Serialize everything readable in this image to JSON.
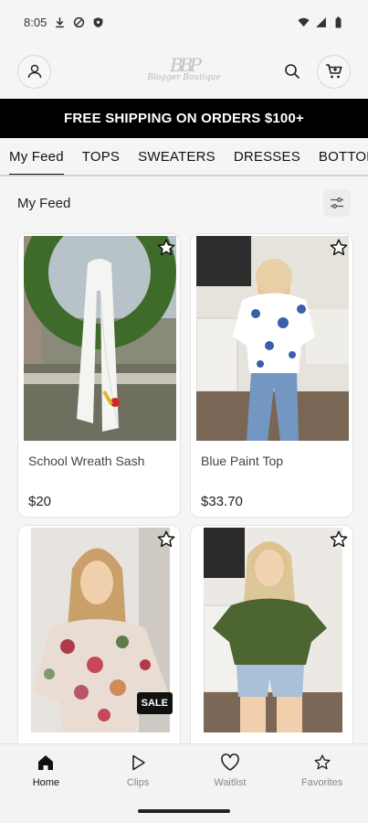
{
  "status_bar": {
    "time": "8:05",
    "icons": [
      "download-icon",
      "shield-icon",
      "shield-alt-icon",
      "wifi-icon",
      "signal-icon",
      "battery-icon"
    ]
  },
  "app_bar": {
    "logo_monogram": "BBP",
    "logo_text": "Blogger Boutique",
    "icons": [
      "profile-icon",
      "search-icon",
      "cart-icon"
    ]
  },
  "banner": {
    "text": "FREE SHIPPING ON ORDERS $100+"
  },
  "tabs": [
    {
      "label": "My Feed",
      "active": true
    },
    {
      "label": "TOPS"
    },
    {
      "label": "SWEATERS"
    },
    {
      "label": "DRESSES"
    },
    {
      "label": "BOTTOMS"
    }
  ],
  "feed": {
    "title": "My Feed",
    "products": [
      {
        "name": "School Wreath Sash",
        "price": "$20"
      },
      {
        "name": "Blue Paint Top",
        "price": "$33.70"
      },
      {
        "name": "",
        "price": "",
        "badge": "SALE"
      },
      {
        "name": "",
        "price": ""
      }
    ]
  },
  "bottom_nav": [
    {
      "label": "Home",
      "icon": "home-icon",
      "active": true
    },
    {
      "label": "Clips",
      "icon": "play-icon"
    },
    {
      "label": "Waitlist",
      "icon": "heart-icon"
    },
    {
      "label": "Favorites",
      "icon": "star-icon"
    }
  ],
  "colors": {
    "banner_bg": "#000000",
    "accent": "#111111",
    "background": "#f5f5f5"
  }
}
